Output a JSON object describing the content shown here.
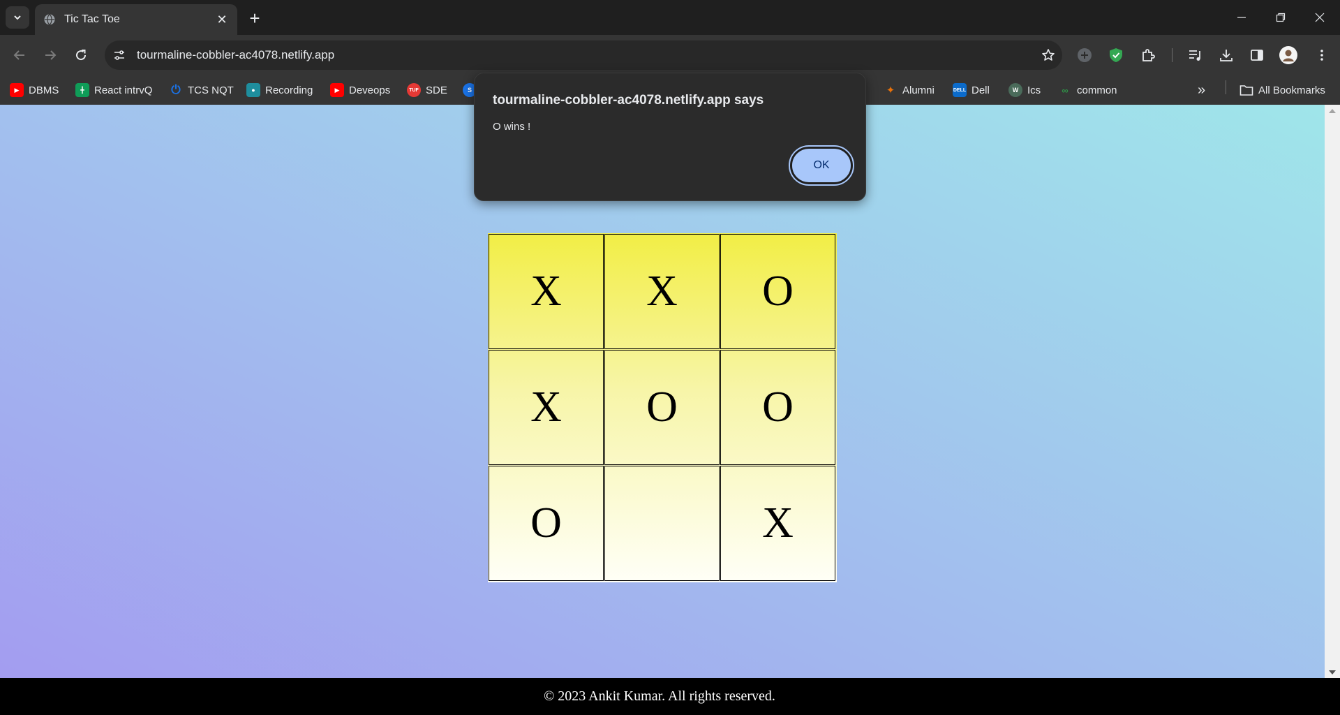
{
  "browser": {
    "tab_title": "Tic Tac Toe",
    "url": "tourmaline-cobbler-ac4078.netlify.app",
    "bookmarks": [
      {
        "label": "DBMS",
        "icon": "youtube-icon",
        "color": "#ff0000"
      },
      {
        "label": "React intrvQ",
        "icon": "sheets-icon",
        "color": "#0f9d58"
      },
      {
        "label": "TCS NQT",
        "icon": "power-icon",
        "color": "#1a73e8"
      },
      {
        "label": "Recording",
        "icon": "classroom-icon",
        "color": "#1e8e9e"
      },
      {
        "label": "Deveops",
        "icon": "youtube-icon",
        "color": "#ff0000"
      },
      {
        "label": "SDE",
        "icon": "tuf-icon",
        "color": "#e53935"
      },
      {
        "label": "Alumni",
        "icon": "iitg-icon",
        "color": "#e8710a"
      },
      {
        "label": "Dell",
        "icon": "dell-icon",
        "color": "#0b6bcb"
      },
      {
        "label": "Ics",
        "icon": "w-icon",
        "color": "#4a6b5a"
      },
      {
        "label": "common",
        "icon": "gfg-icon",
        "color": "#2f8d46"
      }
    ],
    "all_bookmarks_label": "All Bookmarks"
  },
  "dialog": {
    "title": "tourmaline-cobbler-ac4078.netlify.app says",
    "message": "O wins !",
    "ok_label": "OK"
  },
  "game": {
    "board": [
      [
        "X",
        "X",
        "O"
      ],
      [
        "X",
        "O",
        "O"
      ],
      [
        "O",
        "",
        "X"
      ]
    ]
  },
  "footer": {
    "text": "© 2023 Ankit Kumar. All rights reserved."
  }
}
